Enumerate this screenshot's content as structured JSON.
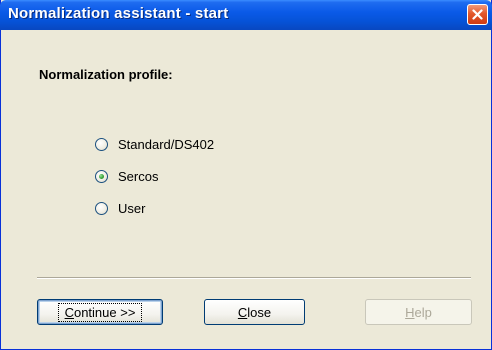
{
  "window": {
    "title": "Normalization assistant - start",
    "close_icon": "close-x-icon",
    "accent_color": "#0a5ae8",
    "close_color": "#e3582c"
  },
  "profile": {
    "label": "Normalization profile:",
    "options": [
      {
        "label": "Standard/DS402",
        "checked": false
      },
      {
        "label": "Sercos",
        "checked": true
      },
      {
        "label": "User",
        "checked": false
      }
    ]
  },
  "buttons": {
    "continue": {
      "mnemonic": "C",
      "rest": "ontinue >>",
      "enabled": true,
      "default": true
    },
    "close": {
      "mnemonic": "C",
      "rest": "lose",
      "enabled": true
    },
    "help": {
      "mnemonic": "H",
      "rest": "elp",
      "enabled": false
    }
  }
}
